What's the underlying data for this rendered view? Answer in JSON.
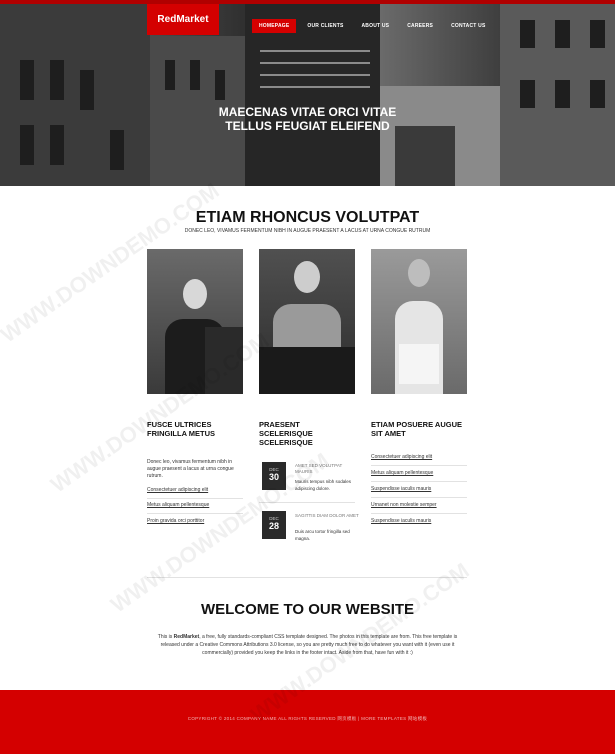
{
  "brand": {
    "logo": "RedMarket",
    "accent": "#d40000"
  },
  "nav": {
    "items": [
      "HOMEPAGE",
      "OUR CLIENTS",
      "ABOUT US",
      "CAREERS",
      "CONTACT US"
    ]
  },
  "hero": {
    "line1": "MAECENAS VITAE ORCI VITAE",
    "line2": "TELLUS FEUGIAT ELEIFEND"
  },
  "section": {
    "title": "ETIAM RHONCUS VOLUTPAT",
    "subtitle": "DONEC LEO, VIVAMUS FERMENTUM NIBH IN AUGUE PRAESENT A LACUS AT URNA CONGUE RUTRUM"
  },
  "columns": [
    {
      "title": "FUSCE ULTRICES FRINGILLA METUS",
      "text": "Donec leo, vivamus fermentum nibh in augue praesent a lacus at urna congue rutrum.",
      "links": [
        "Consectetuer adipiscing elit",
        "Metus aliquam pellentesque",
        "Proin gravida orci porttitor"
      ]
    },
    {
      "title": "PRAESENT SCELERISQUE SCELERISQUE",
      "events": [
        {
          "month": "DEC",
          "day": "30",
          "title": "AMET SED VOLUTPAT MAURIS",
          "desc": "Mauris tempus nibh sodales adipiscing dolore."
        },
        {
          "month": "DEC",
          "day": "28",
          "title": "SAGITTIS DIAM DOLOR AMET",
          "desc": "Duis arcu tortor fringilla sed magna."
        }
      ]
    },
    {
      "title": "ETIAM POSUERE AUGUE SIT AMET",
      "links": [
        "Consectetuer adipiscing elit",
        "Metus aliquam pellentesque",
        "Suspendisse iaculis mauris",
        "Urnanet non molestie semper",
        "Suspendisse iaculis mauris"
      ]
    }
  ],
  "welcome": {
    "title": "WELCOME TO OUR WEBSITE",
    "text_before": "This is ",
    "text_brand": "RedMarket",
    "text_after": ", a free, fully standards-compliant CSS template designed. The photos in this template are from. This free template is released under a Creative Commons Attributions 3.0 license, so you are pretty much free to do whatever you want with it (even use it commercially) provided you keep the links in the footer intact. Aside from that, have fun with it :)"
  },
  "footer": {
    "text": "COPYRIGHT © 2014 COMPANY NAME ALL RIGHTS RESERVED 网页模板 | MORE TEMPLATES 网站模板"
  },
  "watermark": "WWW.DOWNDEMO.COM"
}
